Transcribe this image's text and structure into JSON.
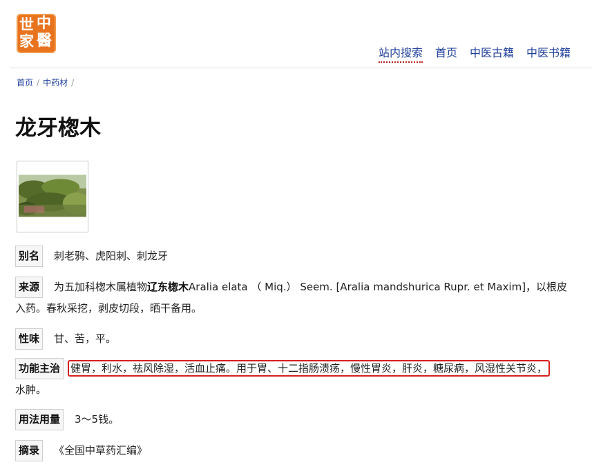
{
  "logo": {
    "chars": [
      "世",
      "中",
      "家",
      "醫"
    ]
  },
  "nav": {
    "search": "站内搜索",
    "home": "首页",
    "classics": "中医古籍",
    "books": "中医书籍"
  },
  "breadcrumb": {
    "home": "首页",
    "category": "中药材",
    "sep": "/"
  },
  "page_title": "龙牙楤木",
  "entries": {
    "alias": {
      "label": "别名",
      "text": "刺老鸦、虎阳刺、刺龙牙"
    },
    "source": {
      "label": "来源",
      "pre": "为五加科楤木属植物",
      "bold": "辽东楤木",
      "post": "Aralia elata （ Miq.） Seem. [Aralia mandshurica Rupr. et Maxim]，以根皮",
      "line2": "入药。春秋采挖，剥皮切段，晒干备用。"
    },
    "taste": {
      "label": "性味",
      "text": "甘、苦，平。"
    },
    "function": {
      "label": "功能主治",
      "highlighted": "健胃，利水，祛风除湿，活血止痛。用于胃、十二指肠溃疡，慢性胃炎，肝炎，糖尿病，风湿性关节炎，",
      "line2": "水肿。"
    },
    "dosage": {
      "label": "用法用量",
      "text": "3～5钱。"
    },
    "excerpt": {
      "label": "摘录",
      "text": "《全国中草药汇编》"
    }
  }
}
